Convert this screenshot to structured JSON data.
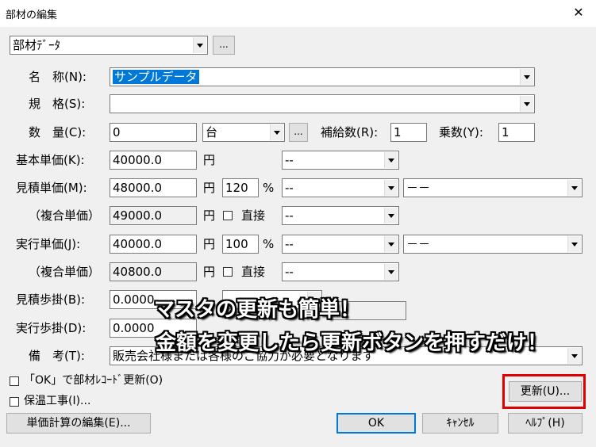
{
  "window": {
    "title": "部材の編集",
    "close": "✕"
  },
  "top": {
    "type_combo": "部材ﾃﾞｰﾀ",
    "browse": "..."
  },
  "labels": {
    "name": "名　称(N):",
    "spec": "規　格(S):",
    "qty": "数　量(C):",
    "base_price": "基本単価(K):",
    "est_price": "見積単価(M):",
    "composite1": "（複合単価）",
    "exec_price": "実行単価(J):",
    "composite2": "（複合単価）",
    "est_rate": "見積歩掛(B):",
    "exec_rate": "実行歩掛(D):",
    "note": "備　考(T):",
    "supp_count": "補給数(R):",
    "multiplier": "乗数(Y):",
    "yen": "円",
    "percent": "%",
    "direct": "直接"
  },
  "values": {
    "name": "サンプルデータ",
    "spec": "",
    "qty": "0",
    "unit": "台",
    "supp_count": "1",
    "multiplier": "1",
    "base_price": "40000.0",
    "base_combo": "--",
    "est_price": "48000.0",
    "est_pct": "120",
    "est_combo1": "--",
    "est_combo2": "－－",
    "composite1": "49000.0",
    "composite1_combo": "--",
    "exec_price": "40000.0",
    "exec_pct": "100",
    "exec_combo1": "--",
    "exec_combo2": "－－",
    "composite2": "40800.0",
    "composite2_combo": "--",
    "est_rate": "0.0000",
    "exec_rate": "0.0000",
    "rate_side": "0.0",
    "note": "販売会社様または各様のご協力が必要となります"
  },
  "checks": {
    "ok_update": "「OK」で部材ﾚｺｰﾄﾞ更新(O)",
    "insulation": "保温工事(I)..."
  },
  "buttons": {
    "unit_calc": "単価計算の編集(E)...",
    "update": "更新(U)...",
    "ok": "OK",
    "cancel": "ｷｬﾝｾﾙ",
    "help": "ﾍﾙﾌﾟ(H)"
  },
  "overlay": {
    "line1": "マスタの更新も簡単！",
    "line2": "金額を変更したら更新ボタンを押すだけ！"
  },
  "colors": {
    "highlight": "#0078d7",
    "callout": "#e00000"
  }
}
